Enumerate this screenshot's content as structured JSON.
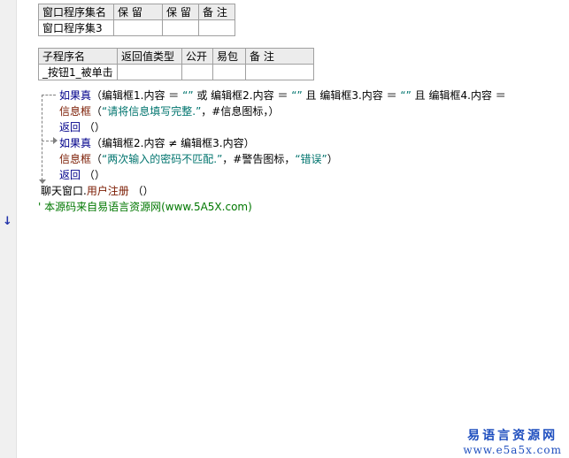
{
  "window_table": {
    "headers": [
      "窗口程序集名",
      "保 留",
      "保 留",
      "备 注"
    ],
    "row": [
      "窗口程序集3",
      "",
      "",
      ""
    ]
  },
  "sub_table": {
    "headers": [
      "子程序名",
      "返回值类型",
      "公开",
      "易包",
      "备 注"
    ],
    "row": [
      "_按钮1_被单击",
      "",
      "",
      "",
      ""
    ]
  },
  "code": {
    "line1": {
      "kw": "如果真",
      "open": "（编辑框1.内容 ＝ ",
      "q1": "“”",
      "or": " 或 编辑框2.内容 ＝ ",
      "q2": "“”",
      "and1": " 且 编辑框3.内容 ＝ ",
      "q3": "“”",
      "and2": " 且 编辑框4.内容 ＝"
    },
    "line2": {
      "fn": "信息框",
      "open": "（",
      "msg": "“请将信息填写完整.”",
      "rest": "，#信息图标，）"
    },
    "line3": {
      "kw": "返回",
      "rest": " （）"
    },
    "line4": {
      "kw": "如果真",
      "rest": "（编辑框2.内容 ≠ 编辑框3.内容）"
    },
    "line5": {
      "fn": "信息框",
      "open": "（",
      "msg": "“两次输入的密码不匹配.”",
      "mid": "，#警告图标，",
      "title": "“错误”",
      "close": "）"
    },
    "line6": {
      "kw": "返回",
      "rest": " （）"
    },
    "line7": {
      "obj": "聊天窗口.",
      "method": "用户注册",
      "rest": " （）"
    },
    "comment": "' 本源码来自易语言资源网(www.5A5X.com)"
  },
  "watermark": {
    "line1": "易语言资源网",
    "line2": "www.e5a5x.com"
  }
}
